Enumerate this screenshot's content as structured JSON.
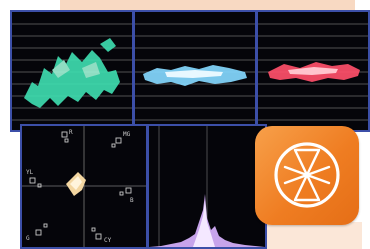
{
  "colors": {
    "background": "#ffffff",
    "peach_panel": "#f8d9c2",
    "scope_background": "#05050a",
    "scope_border": "#3c4fa8",
    "gridline": "#6b6b6b",
    "waveform_green": "#3fe0b2",
    "waveform_blue": "#84d8ff",
    "waveform_red": "#ff4f6a",
    "histogram_violet": "#d8b2ff",
    "vectorscope_trace": "#f3d6a1",
    "app_icon_orange": "#ef7d22",
    "app_icon_glyph": "#ffffff"
  },
  "scopes": {
    "waveform_green_label": "",
    "vectorscope": {
      "targets": [
        "R",
        "MG",
        "YL",
        "B",
        "G",
        "CY"
      ]
    }
  },
  "app_icon": {
    "icon": "hourglass-app-icon"
  }
}
